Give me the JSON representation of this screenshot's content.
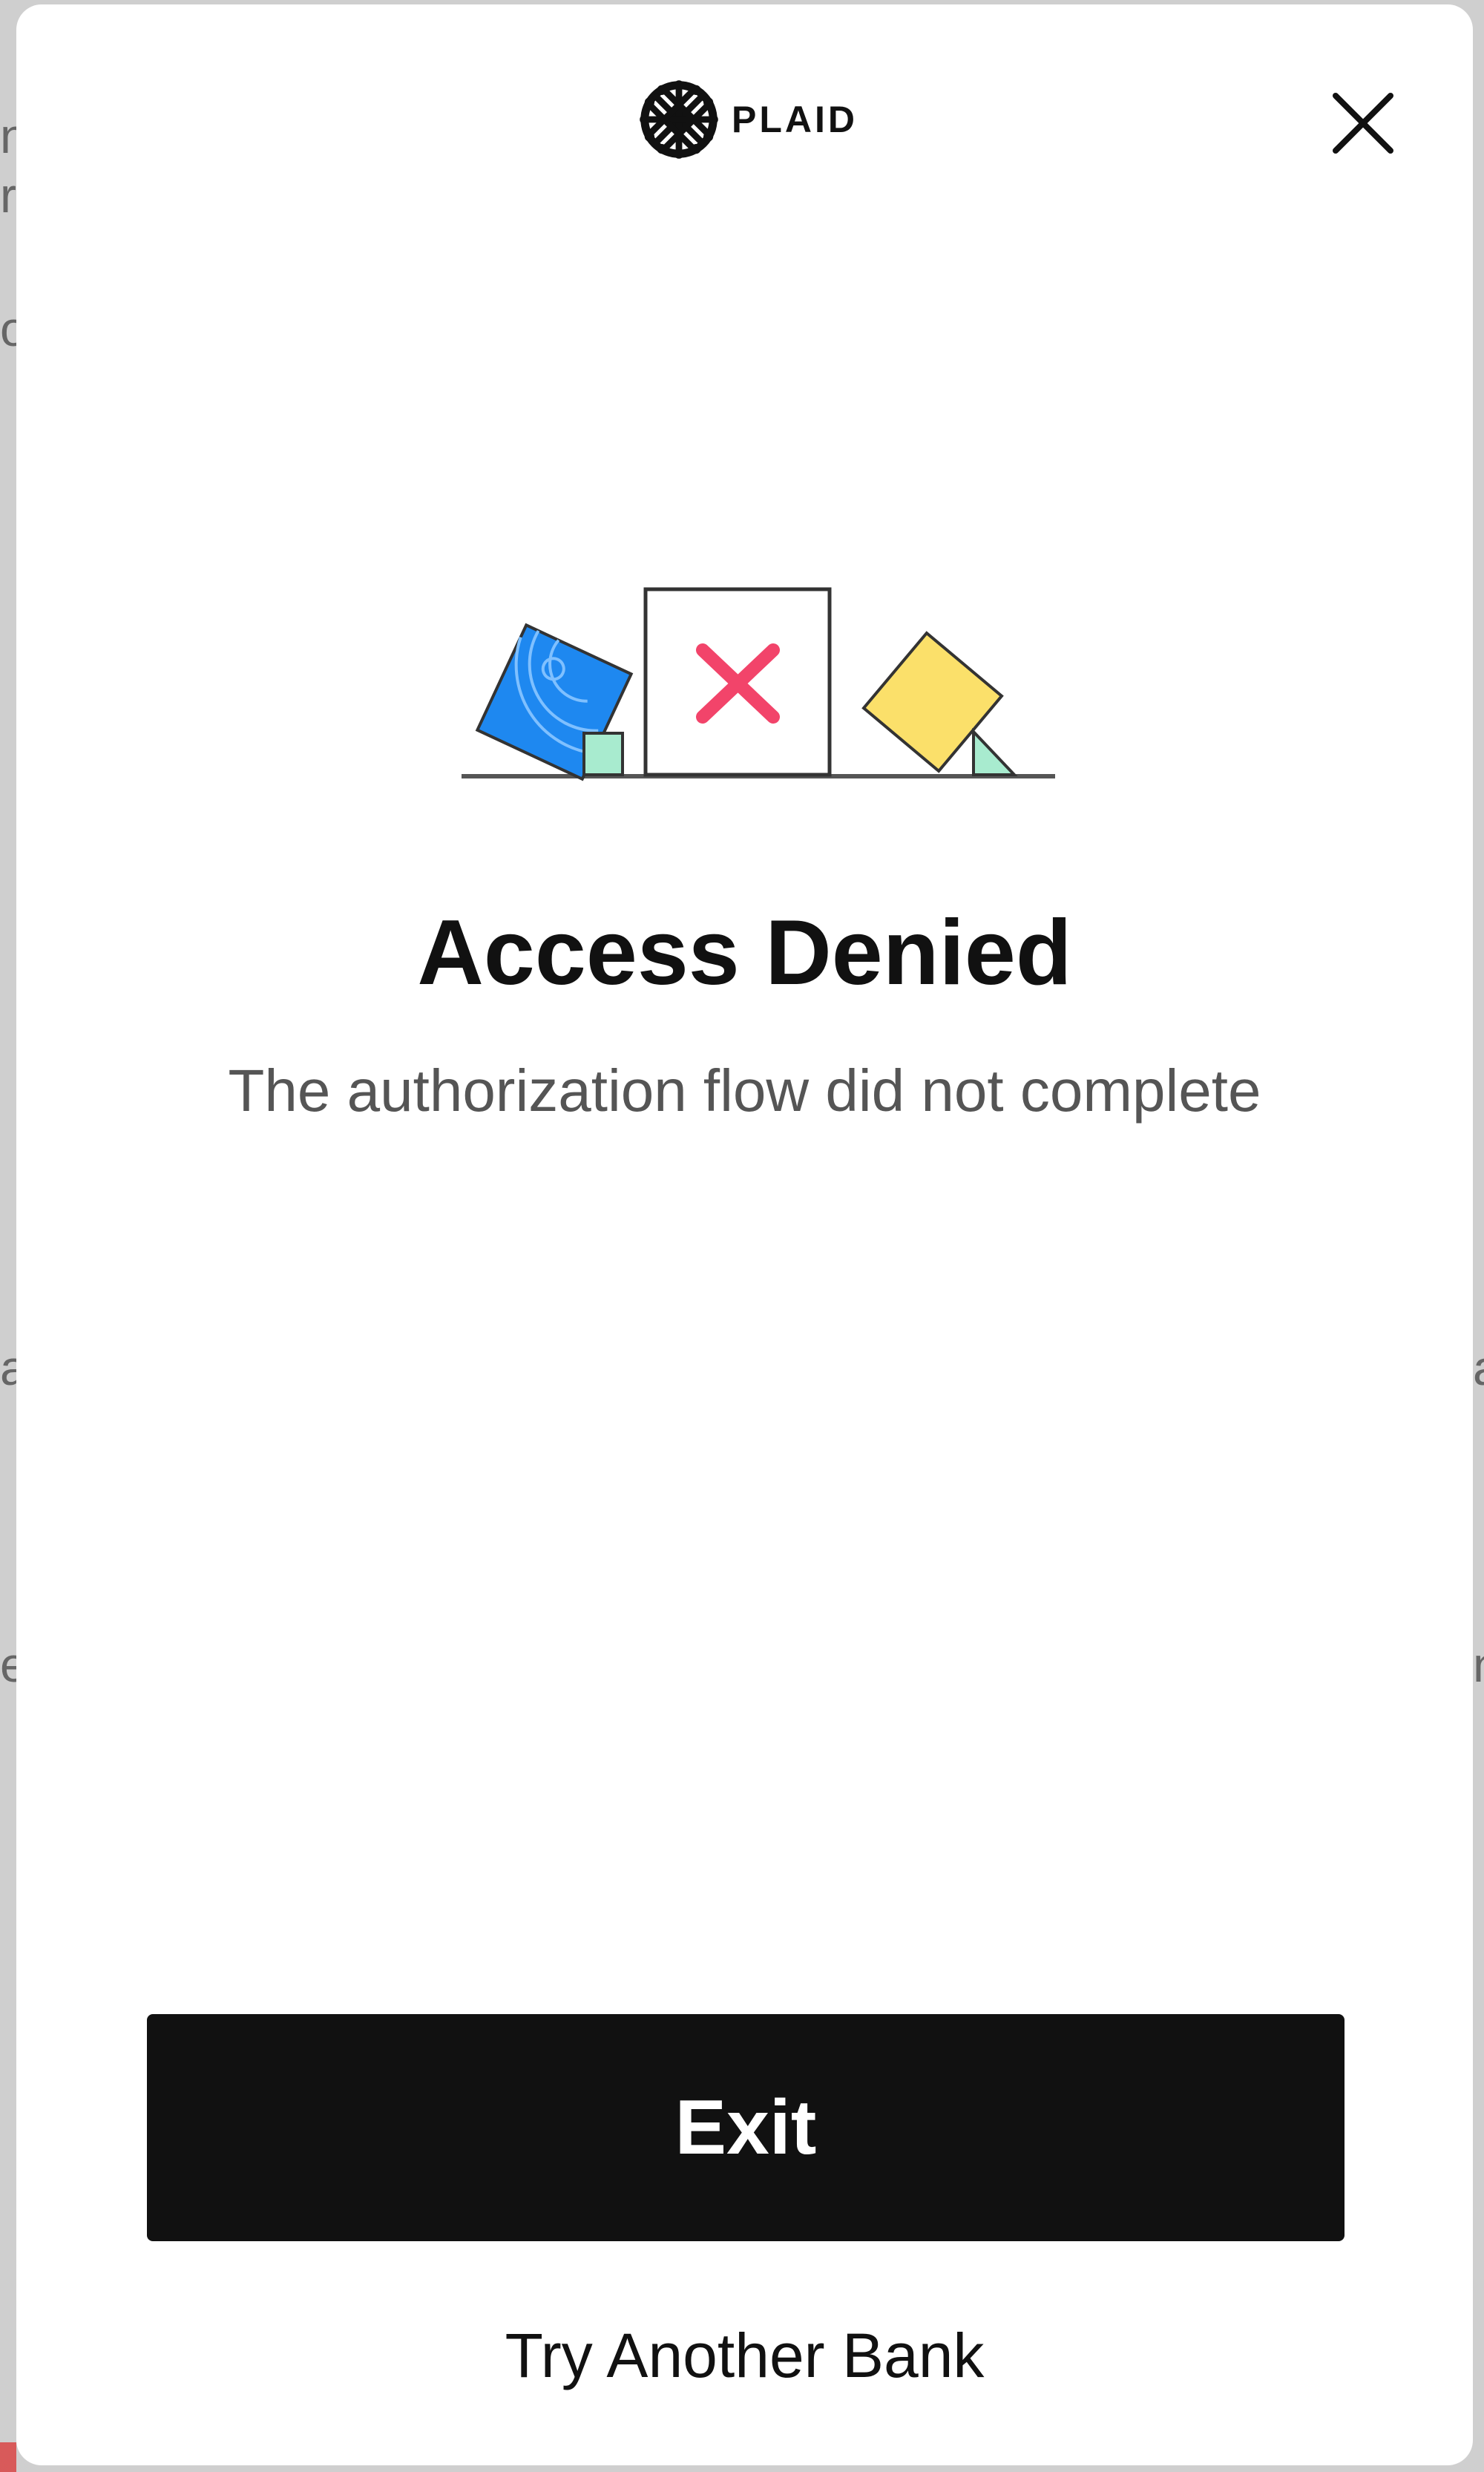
{
  "brand": {
    "name": "PLAID"
  },
  "dialog": {
    "title": "Access Denied",
    "message": "The authorization flow did not complete",
    "primary_button": "Exit",
    "secondary_link": "Try Another Bank",
    "close_icon": "close-icon"
  },
  "colors": {
    "primary_button_bg": "#111111",
    "error_x": "#F2446A",
    "blue_tile": "#1E88F0",
    "yellow_tile": "#FBE06A",
    "mint_accent": "#A8EBCF"
  }
}
